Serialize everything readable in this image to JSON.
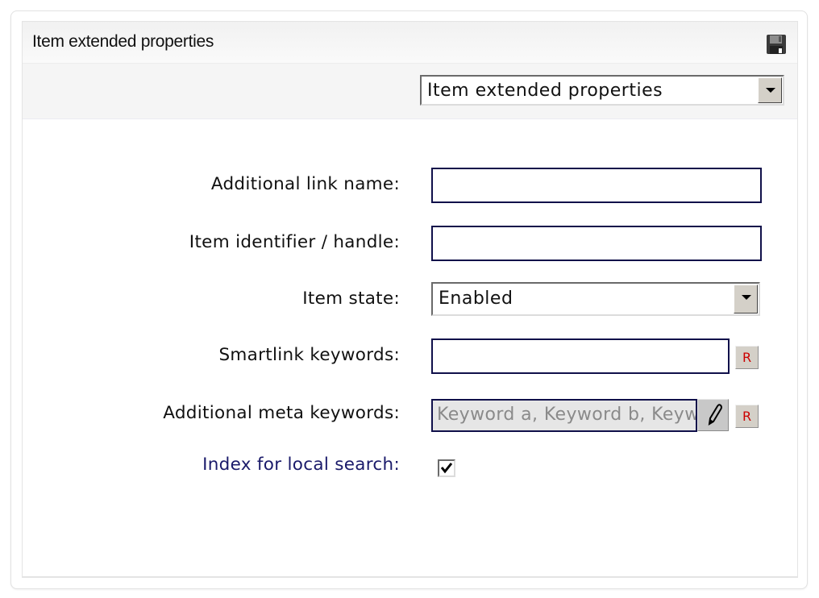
{
  "panel": {
    "title": "Item extended properties",
    "save_icon": "floppy-disk-icon"
  },
  "toolbar": {
    "view_select": {
      "value": "Item extended properties"
    }
  },
  "form": {
    "fields": [
      {
        "label": "Additional link name:",
        "type": "text",
        "value": ""
      },
      {
        "label": "Item identifier / handle:",
        "type": "text",
        "value": ""
      },
      {
        "label": "Item state:",
        "type": "select",
        "value": "Enabled"
      },
      {
        "label": "Smartlink keywords:",
        "type": "text",
        "value": "",
        "reset_label": "R"
      },
      {
        "label": "Additional meta keywords:",
        "type": "text",
        "value": "Keyword a, Keyword b, Keyword c",
        "edit_icon": "pencil-icon",
        "reset_label": "R"
      },
      {
        "label": "Index for local search:",
        "type": "checkbox",
        "checked": true
      }
    ]
  }
}
